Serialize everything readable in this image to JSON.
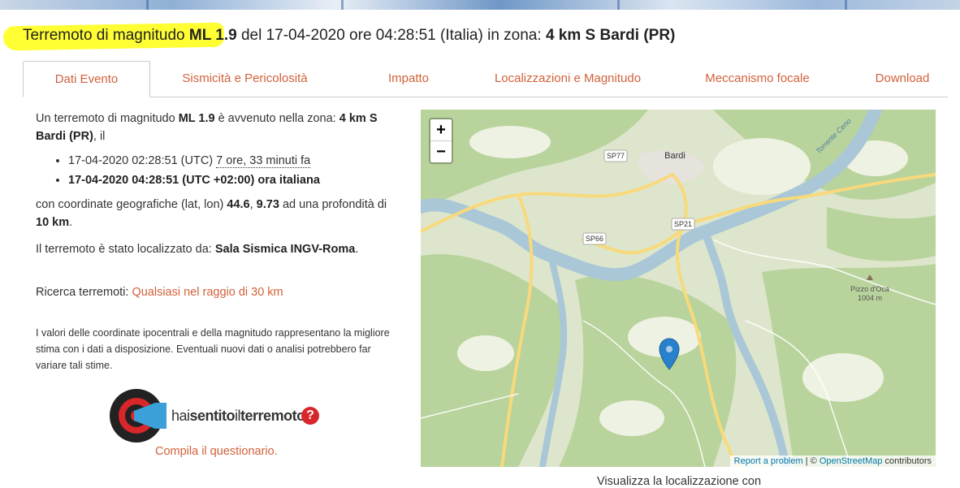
{
  "title": {
    "prefix": "Terremoto di magnitudo",
    "magnitude": "ML 1.9",
    "middle": "del 17-04-2020 ore 04:28:51 (Italia) in zona:",
    "zone": "4 km S Bardi (PR)"
  },
  "tabs": [
    {
      "label": "Dati Evento",
      "active": true
    },
    {
      "label": "Sismicità e Pericolosità"
    },
    {
      "label": "Impatto"
    },
    {
      "label": "Localizzazioni e Magnitudo"
    },
    {
      "label": "Meccanismo focale"
    },
    {
      "label": "Download"
    }
  ],
  "event": {
    "intro_1": "Un terremoto di magnitudo",
    "magnitude": "ML 1.9",
    "intro_2": "è avvenuto nella zona:",
    "zone": "4 km S Bardi (PR)",
    "intro_3": ", il",
    "utc_time": "17-04-2020 02:28:51 (UTC)",
    "ago": "7 ore, 33 minuti fa",
    "local_time": "17-04-2020 04:28:51 (UTC +02:00) ora italiana",
    "coords_1": "con coordinate geografiche (lat, lon)",
    "lat": "44.6",
    "comma": ",",
    "lon": "9.73",
    "coords_2": "ad una profondità di",
    "depth": "10 km",
    "period": ".",
    "loc_1": "Il terremoto è stato localizzato da:",
    "loc_by": "Sala Sismica INGV-Roma",
    "search_label": "Ricerca terremoti:",
    "search_link": "Qualsiasi nel raggio di 30 km",
    "disclaimer": "I valori delle coordinate ipocentrali e della magnitudo rappresentano la migliore stima con i dati a disposizione. Eventuali nuovi dati o analisi potrebbero far variare tali stime."
  },
  "hst": {
    "part1": "hai",
    "part2": "sentito",
    "part3": "il",
    "part4": "terremoto",
    "qmark": "?",
    "cta": "Compila il questionario."
  },
  "map": {
    "zoom_in": "+",
    "zoom_out": "−",
    "labels": {
      "bardi": "Bardi",
      "sp77": "SP77",
      "sp66": "SP66",
      "sp21": "SP21",
      "river": "Torrente Ceno",
      "peak_name": "Pizzo d'Oca",
      "peak_elev": "1004 m"
    },
    "attribution": {
      "report": "Report a problem",
      "sep": " | © ",
      "osm": "OpenStreetMap",
      "contrib": " contributors"
    }
  },
  "below_map": "Visualizza la localizzazione con",
  "colors": {
    "accent": "#d2613a",
    "highlight": "#ffff33",
    "water": "#a9c7d6",
    "road": "#f8d97c",
    "forest": "#b9d39c",
    "marker": "#2a81cb"
  }
}
